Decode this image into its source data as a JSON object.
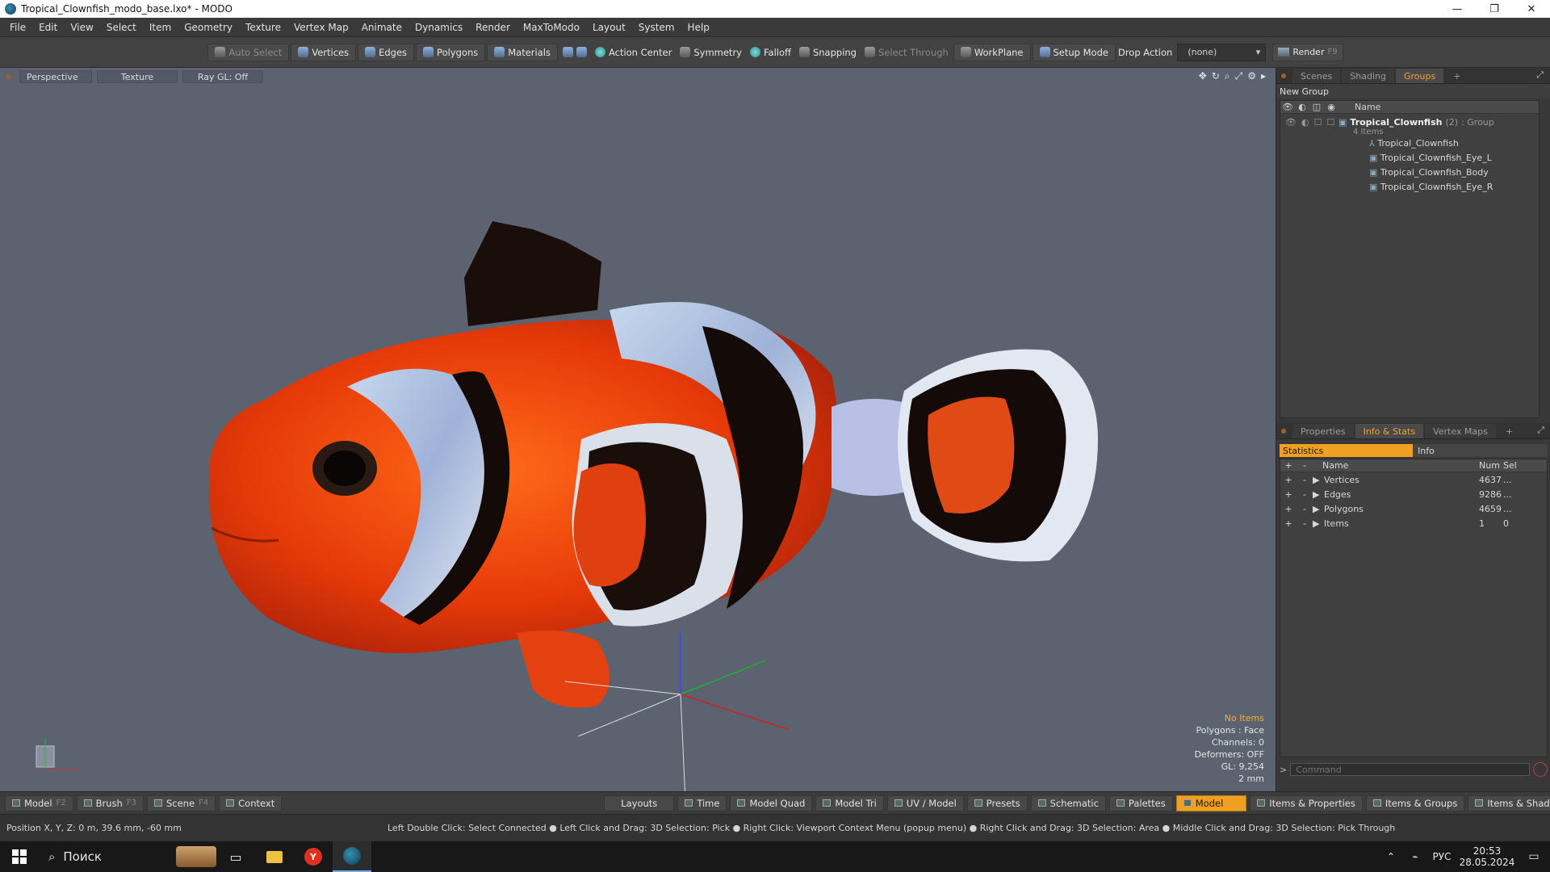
{
  "window": {
    "title": "Tropical_Clownfish_modo_base.lxo* - MODO",
    "controls": [
      "—",
      "❐",
      "✕"
    ]
  },
  "menu": [
    "File",
    "Edit",
    "View",
    "Select",
    "Item",
    "Geometry",
    "Texture",
    "Vertex Map",
    "Animate",
    "Dynamics",
    "Render",
    "MaxToModo",
    "Layout",
    "System",
    "Help"
  ],
  "toolbar": {
    "auto_select": "Auto Select",
    "vertices": "Vertices",
    "edges": "Edges",
    "polygons": "Polygons",
    "materials": "Materials",
    "action_center": "Action Center",
    "symmetry": "Symmetry",
    "falloff": "Falloff",
    "snapping": "Snapping",
    "select_through": "Select Through",
    "workplane": "WorkPlane",
    "setup_mode": "Setup Mode",
    "drop_action_label": "Drop Action",
    "drop_action_value": "(none)",
    "render": "Render",
    "render_key": "F9"
  },
  "viewport": {
    "tabs": [
      "Perspective",
      "Texture",
      "Ray GL: Off"
    ],
    "info": {
      "items": "No Items",
      "polygons": "Polygons : Face",
      "channels": "Channels: 0",
      "deformers": "Deformers: OFF",
      "gl": "GL: 9,254",
      "scale": "2 mm"
    }
  },
  "groups_panel": {
    "tabs": [
      "Scenes",
      "Shading",
      "Groups",
      "+"
    ],
    "active_tab": "Groups",
    "new_group": "New Group",
    "name_header": "Name",
    "group": {
      "name": "Tropical_Clownfish",
      "count": "(2)",
      "type": ": Group",
      "sub": "4 Items"
    },
    "items": [
      "Tropical_Clownfish",
      "Tropical_Clownfish_Eye_L",
      "Tropical_Clownfish_Body",
      "Tropical_Clownfish_Eye_R"
    ]
  },
  "info_panel": {
    "tabs": [
      "Properties",
      "Info & Stats",
      "Vertex Maps",
      "+"
    ],
    "active_tab": "Info & Stats",
    "subtabs": [
      "Statistics",
      "Info"
    ],
    "headers": {
      "name": "Name",
      "num": "Num",
      "sel": "Sel"
    },
    "rows": [
      {
        "name": "Vertices",
        "num": "4637",
        "sel": "..."
      },
      {
        "name": "Edges",
        "num": "9286",
        "sel": "..."
      },
      {
        "name": "Polygons",
        "num": "4659",
        "sel": "..."
      },
      {
        "name": "Items",
        "num": "1",
        "sel": "0"
      }
    ],
    "command_placeholder": "Command"
  },
  "bottom_bar": {
    "left": [
      {
        "label": "Model",
        "key": "F2"
      },
      {
        "label": "Brush",
        "key": "F3"
      },
      {
        "label": "Scene",
        "key": "F4"
      },
      {
        "label": "Context",
        "key": ""
      }
    ],
    "center": [
      "Layouts",
      "Time",
      "Model Quad",
      "Model Tri",
      "UV / Model",
      "Presets",
      "Schematic"
    ],
    "right": [
      "Palettes",
      "Model",
      "Items & Properties",
      "Items & Groups",
      "Items & Shading"
    ],
    "active": "Model"
  },
  "status": {
    "position": "Position X, Y, Z:  0 m, 39.6 mm, -60 mm",
    "hint": "Left Double Click: Select Connected ● Left Click and Drag: 3D Selection: Pick ● Right Click: Viewport Context Menu (popup menu) ● Right Click and Drag: 3D Selection: Area ● Middle Click and Drag: 3D Selection: Pick Through"
  },
  "taskbar": {
    "search": "Поиск",
    "lang": "РУС",
    "time": "20:53",
    "date": "28.05.2024"
  },
  "colors": {
    "accent": "#f0a020",
    "viewport_bg": "#5c6370",
    "fish_orange": "#e8400a"
  }
}
